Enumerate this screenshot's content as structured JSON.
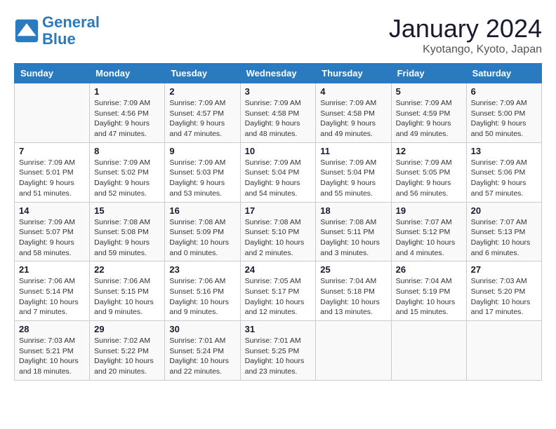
{
  "header": {
    "logo_line1": "General",
    "logo_line2": "Blue",
    "month": "January 2024",
    "location": "Kyotango, Kyoto, Japan"
  },
  "weekdays": [
    "Sunday",
    "Monday",
    "Tuesday",
    "Wednesday",
    "Thursday",
    "Friday",
    "Saturday"
  ],
  "weeks": [
    [
      {
        "day": "",
        "info": ""
      },
      {
        "day": "1",
        "info": "Sunrise: 7:09 AM\nSunset: 4:56 PM\nDaylight: 9 hours\nand 47 minutes."
      },
      {
        "day": "2",
        "info": "Sunrise: 7:09 AM\nSunset: 4:57 PM\nDaylight: 9 hours\nand 47 minutes."
      },
      {
        "day": "3",
        "info": "Sunrise: 7:09 AM\nSunset: 4:58 PM\nDaylight: 9 hours\nand 48 minutes."
      },
      {
        "day": "4",
        "info": "Sunrise: 7:09 AM\nSunset: 4:58 PM\nDaylight: 9 hours\nand 49 minutes."
      },
      {
        "day": "5",
        "info": "Sunrise: 7:09 AM\nSunset: 4:59 PM\nDaylight: 9 hours\nand 49 minutes."
      },
      {
        "day": "6",
        "info": "Sunrise: 7:09 AM\nSunset: 5:00 PM\nDaylight: 9 hours\nand 50 minutes."
      }
    ],
    [
      {
        "day": "7",
        "info": "Sunrise: 7:09 AM\nSunset: 5:01 PM\nDaylight: 9 hours\nand 51 minutes."
      },
      {
        "day": "8",
        "info": "Sunrise: 7:09 AM\nSunset: 5:02 PM\nDaylight: 9 hours\nand 52 minutes."
      },
      {
        "day": "9",
        "info": "Sunrise: 7:09 AM\nSunset: 5:03 PM\nDaylight: 9 hours\nand 53 minutes."
      },
      {
        "day": "10",
        "info": "Sunrise: 7:09 AM\nSunset: 5:04 PM\nDaylight: 9 hours\nand 54 minutes."
      },
      {
        "day": "11",
        "info": "Sunrise: 7:09 AM\nSunset: 5:04 PM\nDaylight: 9 hours\nand 55 minutes."
      },
      {
        "day": "12",
        "info": "Sunrise: 7:09 AM\nSunset: 5:05 PM\nDaylight: 9 hours\nand 56 minutes."
      },
      {
        "day": "13",
        "info": "Sunrise: 7:09 AM\nSunset: 5:06 PM\nDaylight: 9 hours\nand 57 minutes."
      }
    ],
    [
      {
        "day": "14",
        "info": "Sunrise: 7:09 AM\nSunset: 5:07 PM\nDaylight: 9 hours\nand 58 minutes."
      },
      {
        "day": "15",
        "info": "Sunrise: 7:08 AM\nSunset: 5:08 PM\nDaylight: 9 hours\nand 59 minutes."
      },
      {
        "day": "16",
        "info": "Sunrise: 7:08 AM\nSunset: 5:09 PM\nDaylight: 10 hours\nand 0 minutes."
      },
      {
        "day": "17",
        "info": "Sunrise: 7:08 AM\nSunset: 5:10 PM\nDaylight: 10 hours\nand 2 minutes."
      },
      {
        "day": "18",
        "info": "Sunrise: 7:08 AM\nSunset: 5:11 PM\nDaylight: 10 hours\nand 3 minutes."
      },
      {
        "day": "19",
        "info": "Sunrise: 7:07 AM\nSunset: 5:12 PM\nDaylight: 10 hours\nand 4 minutes."
      },
      {
        "day": "20",
        "info": "Sunrise: 7:07 AM\nSunset: 5:13 PM\nDaylight: 10 hours\nand 6 minutes."
      }
    ],
    [
      {
        "day": "21",
        "info": "Sunrise: 7:06 AM\nSunset: 5:14 PM\nDaylight: 10 hours\nand 7 minutes."
      },
      {
        "day": "22",
        "info": "Sunrise: 7:06 AM\nSunset: 5:15 PM\nDaylight: 10 hours\nand 9 minutes."
      },
      {
        "day": "23",
        "info": "Sunrise: 7:06 AM\nSunset: 5:16 PM\nDaylight: 10 hours\nand 9 minutes."
      },
      {
        "day": "24",
        "info": "Sunrise: 7:05 AM\nSunset: 5:17 PM\nDaylight: 10 hours\nand 12 minutes."
      },
      {
        "day": "25",
        "info": "Sunrise: 7:04 AM\nSunset: 5:18 PM\nDaylight: 10 hours\nand 13 minutes."
      },
      {
        "day": "26",
        "info": "Sunrise: 7:04 AM\nSunset: 5:19 PM\nDaylight: 10 hours\nand 15 minutes."
      },
      {
        "day": "27",
        "info": "Sunrise: 7:03 AM\nSunset: 5:20 PM\nDaylight: 10 hours\nand 17 minutes."
      }
    ],
    [
      {
        "day": "28",
        "info": "Sunrise: 7:03 AM\nSunset: 5:21 PM\nDaylight: 10 hours\nand 18 minutes."
      },
      {
        "day": "29",
        "info": "Sunrise: 7:02 AM\nSunset: 5:22 PM\nDaylight: 10 hours\nand 20 minutes."
      },
      {
        "day": "30",
        "info": "Sunrise: 7:01 AM\nSunset: 5:24 PM\nDaylight: 10 hours\nand 22 minutes."
      },
      {
        "day": "31",
        "info": "Sunrise: 7:01 AM\nSunset: 5:25 PM\nDaylight: 10 hours\nand 23 minutes."
      },
      {
        "day": "",
        "info": ""
      },
      {
        "day": "",
        "info": ""
      },
      {
        "day": "",
        "info": ""
      }
    ]
  ]
}
